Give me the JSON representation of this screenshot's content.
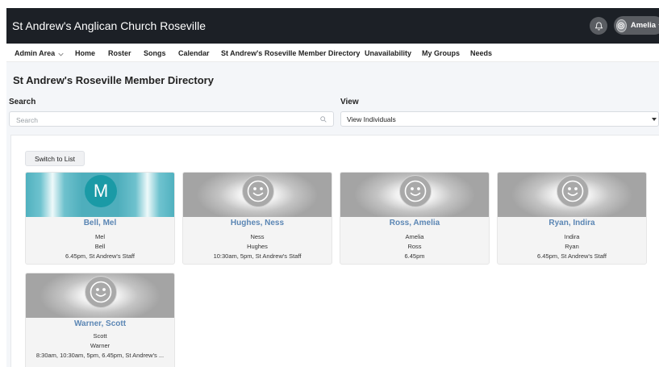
{
  "app": {
    "title": "St Andrew's Anglican Church Roseville",
    "user_name": "Amelia"
  },
  "icons": {
    "bell": "bell-icon",
    "user_avatar": "user-avatar-icon",
    "chevron": "chevron-down-icon",
    "search": "search-icon",
    "caret": "caret-down-icon",
    "smiley": "smiley-face-icon"
  },
  "colors": {
    "topbar": "#1c2026",
    "link": "#5b86b4",
    "teal": "#1a9aa6"
  },
  "nav": {
    "items": [
      {
        "label": "Admin Area"
      },
      {
        "label": "Home"
      },
      {
        "label": "Roster"
      },
      {
        "label": "Songs"
      },
      {
        "label": "Calendar"
      },
      {
        "label": "St Andrew's Roseville Member Directory"
      },
      {
        "label": "Unavailability"
      },
      {
        "label": "My Groups"
      },
      {
        "label": "Needs"
      }
    ]
  },
  "page": {
    "title": "St Andrew's Roseville Member Directory",
    "search_label": "Search",
    "search_placeholder": "Search",
    "view_label": "View",
    "view_value": "View Individuals",
    "switch_button": "Switch to List"
  },
  "members": [
    {
      "name": "Bell, Mel",
      "first": "Mel",
      "last": "Bell",
      "detail": "6.45pm, St Andrew's Staff",
      "avatar_letter": "M"
    },
    {
      "name": "Hughes, Ness",
      "first": "Ness",
      "last": "Hughes",
      "detail": "10:30am, 5pm, St Andrew's Staff"
    },
    {
      "name": "Ross, Amelia",
      "first": "Amelia",
      "last": "Ross",
      "detail": "6.45pm"
    },
    {
      "name": "Ryan, Indira",
      "first": "Indira",
      "last": "Ryan",
      "detail": "6.45pm, St Andrew's Staff"
    },
    {
      "name": "Warner, Scott",
      "first": "Scott",
      "last": "Warner",
      "detail": "8:30am, 10:30am, 5pm, 6.45pm, St Andrew's ..."
    }
  ]
}
